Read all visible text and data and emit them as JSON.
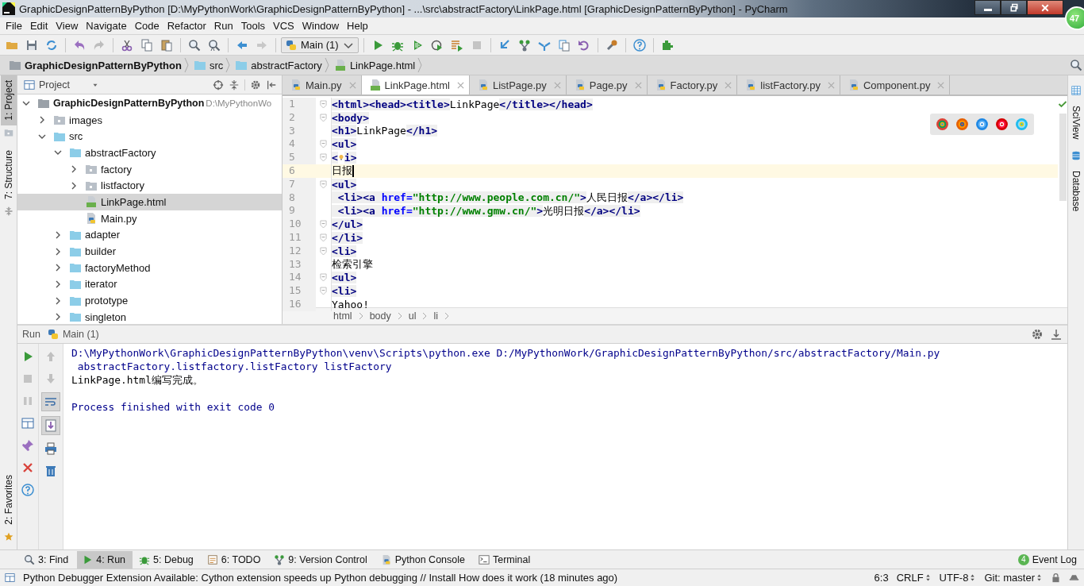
{
  "window": {
    "title": "GraphicDesignPatternByPython [D:\\MyPythonWork\\GraphicDesignPatternByPython] - ...\\src\\abstractFactory\\LinkPage.html [GraphicDesignPatternByPython] - PyCharm"
  },
  "menu": [
    "File",
    "Edit",
    "View",
    "Navigate",
    "Code",
    "Refactor",
    "Run",
    "Tools",
    "VCS",
    "Window",
    "Help"
  ],
  "run_config": {
    "label": "Main (1)"
  },
  "nav_path": [
    {
      "label": "GraphicDesignPatternByPython",
      "kind": "project"
    },
    {
      "label": "src",
      "kind": "folder"
    },
    {
      "label": "abstractFactory",
      "kind": "folder"
    },
    {
      "label": "LinkPage.html",
      "kind": "html"
    }
  ],
  "left_stripe": [
    {
      "label": "1: Project",
      "selected": true
    },
    {
      "label": "7: Structure",
      "selected": false
    }
  ],
  "favorites": {
    "label": "2: Favorites"
  },
  "right_stripe": [
    {
      "label": "SciView"
    },
    {
      "label": "Database"
    }
  ],
  "project_panel": {
    "title": "Project",
    "tree": [
      {
        "label": "GraphicDesignPatternByPython",
        "hint": "D:\\MyPythonWo",
        "kind": "project",
        "expanded": true,
        "selected": false,
        "children": [
          {
            "label": "images",
            "kind": "package",
            "expanded": false,
            "selected": false
          },
          {
            "label": "src",
            "kind": "folder",
            "expanded": true,
            "selected": false,
            "children": [
              {
                "label": "abstractFactory",
                "kind": "folder",
                "expanded": true,
                "selected": false,
                "children": [
                  {
                    "label": "factory",
                    "kind": "package",
                    "expanded": false,
                    "selected": false
                  },
                  {
                    "label": "listfactory",
                    "kind": "package",
                    "expanded": false,
                    "selected": false
                  },
                  {
                    "label": "LinkPage.html",
                    "kind": "html",
                    "selected": true
                  },
                  {
                    "label": "Main.py",
                    "kind": "python",
                    "selected": false
                  }
                ]
              },
              {
                "label": "adapter",
                "kind": "folder",
                "expanded": false,
                "selected": false
              },
              {
                "label": "builder",
                "kind": "folder",
                "expanded": false,
                "selected": false
              },
              {
                "label": "factoryMethod",
                "kind": "folder",
                "expanded": false,
                "selected": false
              },
              {
                "label": "iterator",
                "kind": "folder",
                "expanded": false,
                "selected": false
              },
              {
                "label": "prototype",
                "kind": "folder",
                "expanded": false,
                "selected": false
              },
              {
                "label": "singleton",
                "kind": "folder",
                "expanded": false,
                "selected": false
              }
            ]
          }
        ]
      }
    ]
  },
  "editor": {
    "tabs": [
      {
        "label": "Main.py",
        "kind": "python",
        "selected": false
      },
      {
        "label": "LinkPage.html",
        "kind": "html",
        "selected": true
      },
      {
        "label": "ListPage.py",
        "kind": "python",
        "selected": false
      },
      {
        "label": "Page.py",
        "kind": "python",
        "selected": false
      },
      {
        "label": "Factory.py",
        "kind": "python",
        "selected": false
      },
      {
        "label": "listFactory.py",
        "kind": "python",
        "selected": false
      },
      {
        "label": "Component.py",
        "kind": "python",
        "selected": false
      }
    ],
    "lines": [
      {
        "number": "1",
        "fold": true,
        "current": false,
        "tokens": [
          {
            "text": "<html><head><title>",
            "kind": "tag"
          },
          {
            "text": "LinkPage",
            "kind": "text"
          },
          {
            "text": "</title></head>",
            "kind": "tag"
          }
        ]
      },
      {
        "number": "2",
        "fold": true,
        "current": false,
        "tokens": [
          {
            "text": "<body>",
            "kind": "tag"
          }
        ]
      },
      {
        "number": "3",
        "fold": false,
        "current": false,
        "tokens": [
          {
            "text": "<h1>",
            "kind": "tag"
          },
          {
            "text": "LinkPage",
            "kind": "text"
          },
          {
            "text": "</h1>",
            "kind": "tag"
          }
        ]
      },
      {
        "number": "4",
        "fold": true,
        "current": false,
        "tokens": [
          {
            "text": "<ul>",
            "kind": "tag"
          }
        ]
      },
      {
        "number": "5",
        "fold": true,
        "current": false,
        "tokens": [
          {
            "text": "<",
            "kind": "tag"
          },
          {
            "kind": "bulb"
          },
          {
            "text": "i>",
            "kind": "tag"
          }
        ]
      },
      {
        "number": "6",
        "fold": false,
        "current": true,
        "caret": true,
        "tokens": [
          {
            "text": "日报",
            "kind": "text"
          }
        ]
      },
      {
        "number": "7",
        "fold": true,
        "current": false,
        "tokens": [
          {
            "text": "<ul>",
            "kind": "tag"
          }
        ]
      },
      {
        "number": "8",
        "fold": false,
        "current": false,
        "tokens": [
          {
            "text": " <li><a ",
            "kind": "tag"
          },
          {
            "text": "href=",
            "kind": "attr"
          },
          {
            "text": "\"http://www.people.com.cn/\"",
            "kind": "string"
          },
          {
            "text": ">",
            "kind": "tag"
          },
          {
            "text": "人民日报",
            "kind": "text"
          },
          {
            "text": "</a></li>",
            "kind": "tag"
          }
        ]
      },
      {
        "number": "9",
        "fold": false,
        "current": false,
        "tokens": [
          {
            "text": " <li><a ",
            "kind": "tag"
          },
          {
            "text": "href=",
            "kind": "attr"
          },
          {
            "text": "\"http://www.gmw.cn/\"",
            "kind": "string"
          },
          {
            "text": ">",
            "kind": "tag"
          },
          {
            "text": "光明日报",
            "kind": "text"
          },
          {
            "text": "</a></li>",
            "kind": "tag"
          }
        ]
      },
      {
        "number": "10",
        "fold": true,
        "current": false,
        "tokens": [
          {
            "text": "</ul>",
            "kind": "tag"
          }
        ]
      },
      {
        "number": "11",
        "fold": true,
        "current": false,
        "tokens": [
          {
            "text": "</li>",
            "kind": "tag"
          }
        ]
      },
      {
        "number": "12",
        "fold": true,
        "current": false,
        "tokens": [
          {
            "text": "<li>",
            "kind": "tag"
          }
        ]
      },
      {
        "number": "13",
        "fold": false,
        "current": false,
        "tokens": [
          {
            "text": "检索引擎",
            "kind": "text"
          }
        ]
      },
      {
        "number": "14",
        "fold": true,
        "current": false,
        "tokens": [
          {
            "text": "<ul>",
            "kind": "tag"
          }
        ]
      },
      {
        "number": "15",
        "fold": true,
        "current": false,
        "tokens": [
          {
            "text": "<li>",
            "kind": "tag"
          }
        ]
      },
      {
        "number": "16",
        "fold": false,
        "current": false,
        "tokens": [
          {
            "text": "Yahoo!",
            "kind": "text"
          }
        ]
      }
    ],
    "breadcrumb": [
      "html",
      "body",
      "ul",
      "li"
    ]
  },
  "run_panel": {
    "title": "Run",
    "config": "Main (1)",
    "console": [
      {
        "text": "D:\\MyPythonWork\\GraphicDesignPatternByPython\\venv\\Scripts\\python.exe D:/MyPythonWork/GraphicDesignPatternByPython/src/abstractFactory/Main.py",
        "kind": "command"
      },
      {
        "text": " abstractFactory.listfactory.listFactory listFactory",
        "kind": "command"
      },
      {
        "text": "LinkPage.html编写完成。",
        "kind": "output"
      },
      {
        "text": "Process finished with exit code 0",
        "kind": "exit"
      }
    ]
  },
  "tool_windows": [
    {
      "label": "3: Find",
      "selected": false
    },
    {
      "label": "4: Run",
      "selected": true
    },
    {
      "label": "5: Debug",
      "selected": false
    },
    {
      "label": "6: TODO",
      "selected": false
    },
    {
      "label": "9: Version Control",
      "selected": false
    },
    {
      "label": "Python Console",
      "selected": false
    },
    {
      "label": "Terminal",
      "selected": false
    }
  ],
  "event_log": {
    "label": "Event Log",
    "count": "4"
  },
  "status_bar": {
    "message": "Python Debugger Extension Available: Cython extension speeds up Python debugging // Install How does it work (18 minutes ago)",
    "position": "6:3",
    "line_separator": "CRLF",
    "encoding": "UTF-8",
    "vcs": "Git: master"
  },
  "floating_badge": "47"
}
